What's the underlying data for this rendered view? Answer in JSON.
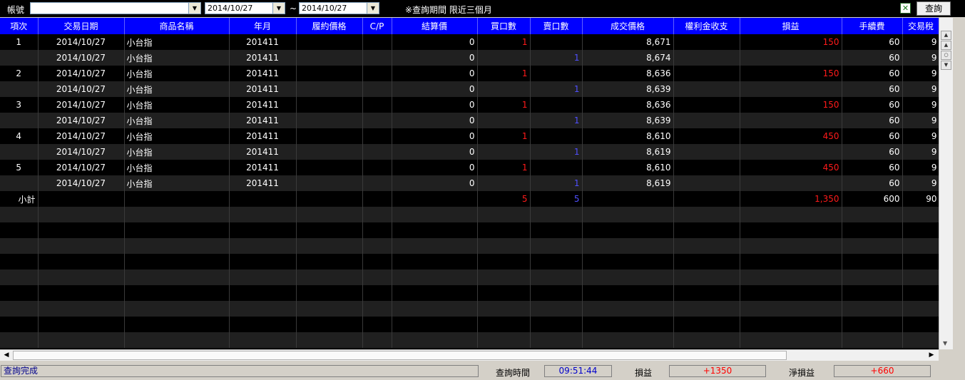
{
  "toolbar": {
    "account_label": "帳號",
    "account_value": "",
    "date_from": "2014/10/27",
    "date_to": "2014/10/27",
    "tilde": "~",
    "note": "※查詢期間 限近三個月",
    "query_button": "查詢",
    "excel_icon": "excel-export-icon"
  },
  "table": {
    "headers": [
      "項次",
      "交易日期",
      "商品名稱",
      "年月",
      "履約價格",
      "C/P",
      "結算價",
      "買口數",
      "賣口數",
      "成交價格",
      "權利金收支",
      "損益",
      "手續費",
      "交易稅"
    ],
    "rows": [
      {
        "idx": "1",
        "date": "2014/10/27",
        "product": "小台指",
        "ym": "201411",
        "strike": "",
        "cp": "",
        "settle": "0",
        "buy": "1",
        "sell": "",
        "price": "8,671",
        "premium": "",
        "pnl": "150",
        "fee": "60",
        "tax": "9"
      },
      {
        "idx": "",
        "date": "2014/10/27",
        "product": "小台指",
        "ym": "201411",
        "strike": "",
        "cp": "",
        "settle": "0",
        "buy": "",
        "sell": "1",
        "price": "8,674",
        "premium": "",
        "pnl": "",
        "fee": "60",
        "tax": "9"
      },
      {
        "idx": "2",
        "date": "2014/10/27",
        "product": "小台指",
        "ym": "201411",
        "strike": "",
        "cp": "",
        "settle": "0",
        "buy": "1",
        "sell": "",
        "price": "8,636",
        "premium": "",
        "pnl": "150",
        "fee": "60",
        "tax": "9"
      },
      {
        "idx": "",
        "date": "2014/10/27",
        "product": "小台指",
        "ym": "201411",
        "strike": "",
        "cp": "",
        "settle": "0",
        "buy": "",
        "sell": "1",
        "price": "8,639",
        "premium": "",
        "pnl": "",
        "fee": "60",
        "tax": "9"
      },
      {
        "idx": "3",
        "date": "2014/10/27",
        "product": "小台指",
        "ym": "201411",
        "strike": "",
        "cp": "",
        "settle": "0",
        "buy": "1",
        "sell": "",
        "price": "8,636",
        "premium": "",
        "pnl": "150",
        "fee": "60",
        "tax": "9"
      },
      {
        "idx": "",
        "date": "2014/10/27",
        "product": "小台指",
        "ym": "201411",
        "strike": "",
        "cp": "",
        "settle": "0",
        "buy": "",
        "sell": "1",
        "price": "8,639",
        "premium": "",
        "pnl": "",
        "fee": "60",
        "tax": "9"
      },
      {
        "idx": "4",
        "date": "2014/10/27",
        "product": "小台指",
        "ym": "201411",
        "strike": "",
        "cp": "",
        "settle": "0",
        "buy": "1",
        "sell": "",
        "price": "8,610",
        "premium": "",
        "pnl": "450",
        "fee": "60",
        "tax": "9"
      },
      {
        "idx": "",
        "date": "2014/10/27",
        "product": "小台指",
        "ym": "201411",
        "strike": "",
        "cp": "",
        "settle": "0",
        "buy": "",
        "sell": "1",
        "price": "8,619",
        "premium": "",
        "pnl": "",
        "fee": "60",
        "tax": "9"
      },
      {
        "idx": "5",
        "date": "2014/10/27",
        "product": "小台指",
        "ym": "201411",
        "strike": "",
        "cp": "",
        "settle": "0",
        "buy": "1",
        "sell": "",
        "price": "8,610",
        "premium": "",
        "pnl": "450",
        "fee": "60",
        "tax": "9"
      },
      {
        "idx": "",
        "date": "2014/10/27",
        "product": "小台指",
        "ym": "201411",
        "strike": "",
        "cp": "",
        "settle": "0",
        "buy": "",
        "sell": "1",
        "price": "8,619",
        "premium": "",
        "pnl": "",
        "fee": "60",
        "tax": "9"
      }
    ],
    "subtotal": {
      "label": "小計",
      "buy": "5",
      "sell": "5",
      "pnl": "1,350",
      "fee": "600",
      "tax": "90"
    }
  },
  "status": {
    "message": "查詢完成",
    "query_time_label": "查詢時間",
    "query_time": "09:51:44",
    "pnl_label": "損益",
    "pnl_value": "+1350",
    "net_pnl_label": "淨損益",
    "net_pnl_value": "+660"
  },
  "colors": {
    "header_bg": "#0000ff",
    "buy": "#ff1a1a",
    "sell": "#5050ff",
    "profit": "#ff1a1a",
    "time": "#0000cc"
  }
}
